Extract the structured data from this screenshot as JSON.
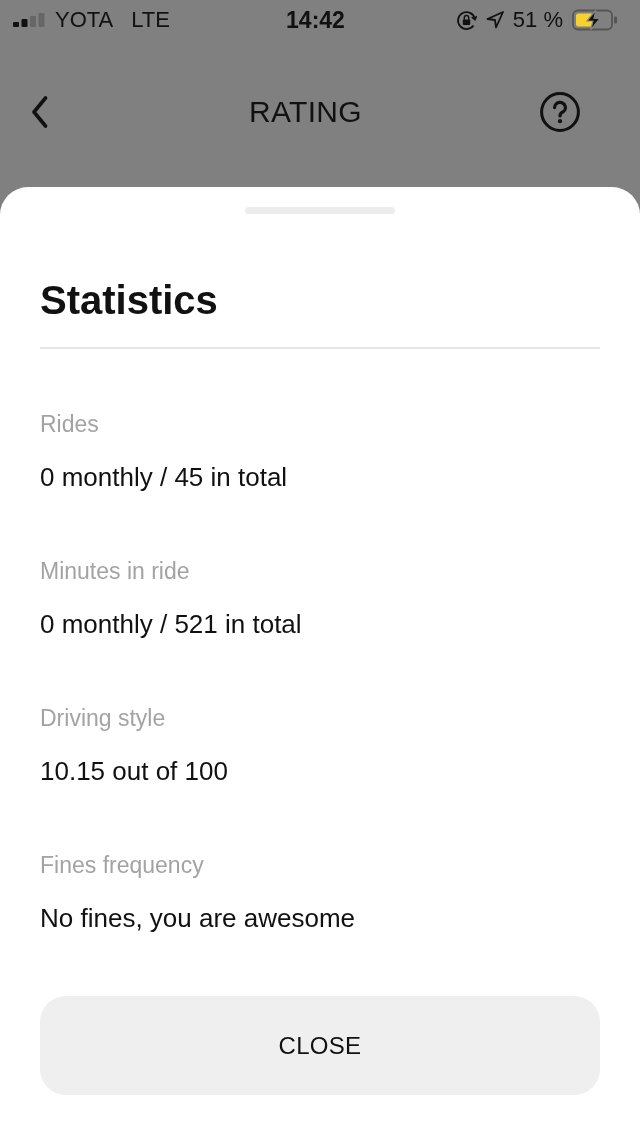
{
  "status_bar": {
    "carrier": "YOTA",
    "network": "LTE",
    "time": "14:42",
    "battery_text": "51 %",
    "charging": true
  },
  "header": {
    "title": "RATING"
  },
  "sheet": {
    "title": "Statistics",
    "stats": [
      {
        "label": "Rides",
        "value": "0 monthly / 45 in total"
      },
      {
        "label": "Minutes in ride",
        "value": "0 monthly / 521 in total"
      },
      {
        "label": "Driving style",
        "value": "10.15 out of 100"
      },
      {
        "label": "Fines frequency",
        "value": "No fines, you are awesome"
      }
    ],
    "button": "CLOSE"
  }
}
